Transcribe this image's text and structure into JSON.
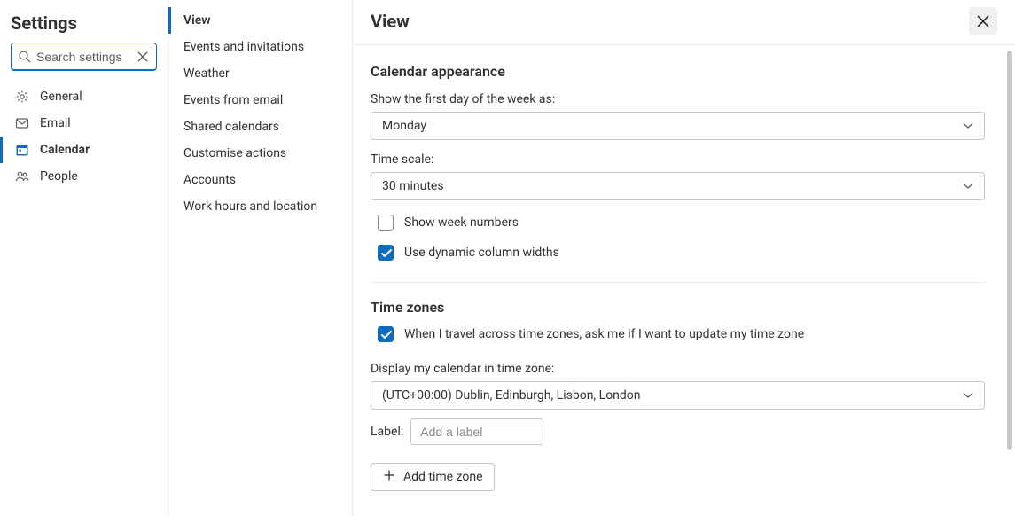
{
  "title": "Settings",
  "search": {
    "placeholder": "Search settings"
  },
  "categories": [
    {
      "id": "general",
      "label": "General",
      "icon": "gear",
      "active": false
    },
    {
      "id": "email",
      "label": "Email",
      "icon": "mail",
      "active": false
    },
    {
      "id": "calendar",
      "label": "Calendar",
      "icon": "calendar",
      "active": true
    },
    {
      "id": "people",
      "label": "People",
      "icon": "people",
      "active": false
    }
  ],
  "subsections": [
    {
      "id": "view",
      "label": "View",
      "active": true
    },
    {
      "id": "events",
      "label": "Events and invitations",
      "active": false
    },
    {
      "id": "weather",
      "label": "Weather",
      "active": false
    },
    {
      "id": "efm",
      "label": "Events from email",
      "active": false
    },
    {
      "id": "shared",
      "label": "Shared calendars",
      "active": false
    },
    {
      "id": "custom",
      "label": "Customise actions",
      "active": false
    },
    {
      "id": "accounts",
      "label": "Accounts",
      "active": false
    },
    {
      "id": "workhours",
      "label": "Work hours and location",
      "active": false
    }
  ],
  "main": {
    "title": "View",
    "appearance": {
      "heading": "Calendar appearance",
      "first_day_label": "Show the first day of the week as:",
      "first_day_value": "Monday",
      "timescale_label": "Time scale:",
      "timescale_value": "30 minutes",
      "week_numbers": {
        "label": "Show week numbers",
        "checked": false
      },
      "dynamic_cols": {
        "label": "Use dynamic column widths",
        "checked": true
      }
    },
    "timezones": {
      "heading": "Time zones",
      "ask_travel": {
        "label": "When I travel across time zones, ask me if I want to update my time zone",
        "checked": true
      },
      "display_label": "Display my calendar in time zone:",
      "display_value": "(UTC+00:00) Dublin, Edinburgh, Lisbon, London",
      "label_label": "Label:",
      "label_placeholder": "Add a label",
      "add_btn": "Add time zone"
    }
  }
}
